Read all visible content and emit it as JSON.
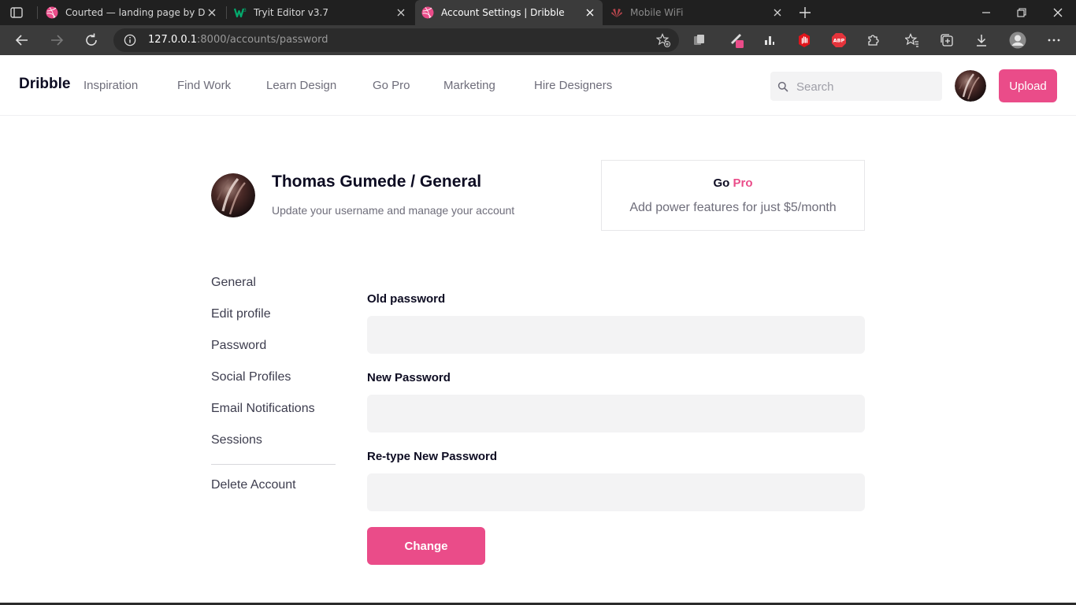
{
  "browser": {
    "tabs": [
      {
        "title": "Courted — landing page by Dan",
        "favicon": "dribbble-icon"
      },
      {
        "title": "Tryit Editor v3.7",
        "favicon": "w3schools-icon"
      },
      {
        "title": "Account Settings | Dribble",
        "favicon": "dribbble-icon",
        "active": true
      },
      {
        "title": "Mobile WiFi",
        "favicon": "huawei-icon"
      }
    ],
    "url_host": "127.0.0.1",
    "url_path": ":8000/accounts/password"
  },
  "header": {
    "logo": "Dribble",
    "nav": [
      "Inspiration",
      "Find Work",
      "Learn Design",
      "Go Pro",
      "Marketing",
      "Hire Designers"
    ],
    "search_placeholder": "Search",
    "upload_label": "Upload"
  },
  "profile": {
    "title": "Thomas Gumede / General",
    "subtitle": "Update your username and manage your account"
  },
  "gopro": {
    "title_prefix": "Go",
    "title_accent": "Pro",
    "text": "Add power features for just $5/month"
  },
  "menu": {
    "items": [
      "General",
      "Edit profile",
      "Password",
      "Social Profiles",
      "Email Notifications",
      "Sessions"
    ],
    "delete_label": "Delete Account"
  },
  "form": {
    "old_password_label": "Old password",
    "new_password_label": "New Password",
    "retype_password_label": "Re-type New Password",
    "old_password_value": "",
    "new_password_value": "",
    "retype_password_value": "",
    "submit_label": "Change"
  },
  "colors": {
    "accent": "#ea4c89",
    "text_dark": "#0d0c22",
    "text_muted": "#6e6d7a",
    "input_bg": "#f3f3f4"
  }
}
